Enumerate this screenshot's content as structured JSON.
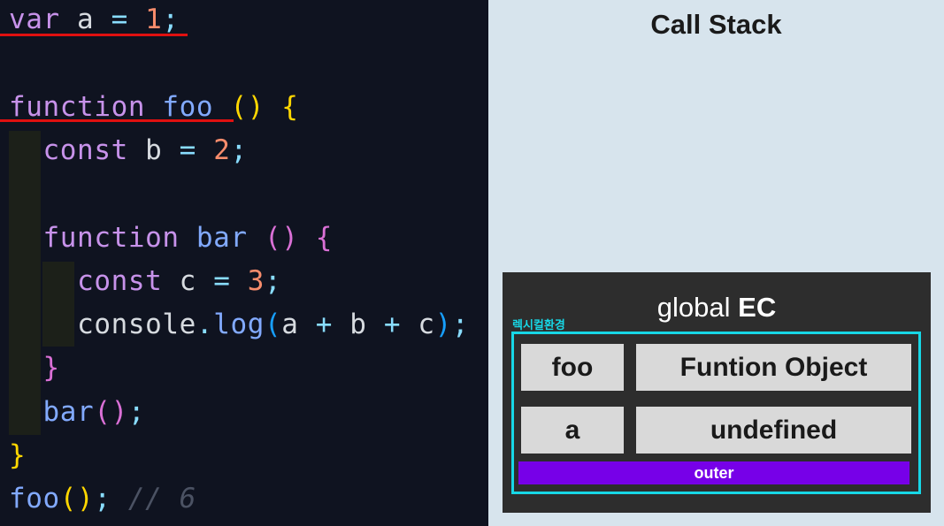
{
  "code": {
    "lines": [
      [
        [
          "var",
          "kw"
        ],
        [
          " a ",
          "var"
        ],
        [
          "=",
          "op"
        ],
        [
          " ",
          "var"
        ],
        [
          "1",
          "num"
        ],
        [
          ";",
          "punc"
        ]
      ],
      [],
      [
        [
          "function",
          "kw"
        ],
        [
          " ",
          "var"
        ],
        [
          "foo",
          "fn"
        ],
        [
          " ",
          "var"
        ],
        [
          "()",
          "brace-y"
        ],
        [
          " ",
          "var"
        ],
        [
          "{",
          "brace-y"
        ]
      ],
      [
        [
          "  ",
          "var"
        ],
        [
          "const",
          "kw"
        ],
        [
          " b ",
          "var"
        ],
        [
          "=",
          "op"
        ],
        [
          " ",
          "var"
        ],
        [
          "2",
          "num"
        ],
        [
          ";",
          "punc"
        ]
      ],
      [],
      [
        [
          "  ",
          "var"
        ],
        [
          "function",
          "kw"
        ],
        [
          " ",
          "var"
        ],
        [
          "bar",
          "fn"
        ],
        [
          " ",
          "var"
        ],
        [
          "()",
          "paren-p"
        ],
        [
          " ",
          "var"
        ],
        [
          "{",
          "paren-p"
        ]
      ],
      [
        [
          "    ",
          "var"
        ],
        [
          "const",
          "kw"
        ],
        [
          " c ",
          "var"
        ],
        [
          "=",
          "op"
        ],
        [
          " ",
          "var"
        ],
        [
          "3",
          "num"
        ],
        [
          ";",
          "punc"
        ]
      ],
      [
        [
          "    ",
          "var"
        ],
        [
          "console",
          "var"
        ],
        [
          ".",
          "punc"
        ],
        [
          "log",
          "fn"
        ],
        [
          "(",
          "paren-b"
        ],
        [
          "a ",
          "var"
        ],
        [
          "+",
          "op"
        ],
        [
          " b ",
          "var"
        ],
        [
          "+",
          "op"
        ],
        [
          " c",
          "var"
        ],
        [
          ")",
          "paren-b"
        ],
        [
          ";",
          "punc"
        ]
      ],
      [
        [
          "  ",
          "var"
        ],
        [
          "}",
          "paren-p"
        ]
      ],
      [
        [
          "  ",
          "var"
        ],
        [
          "bar",
          "fn"
        ],
        [
          "()",
          "paren-p"
        ],
        [
          ";",
          "punc"
        ]
      ],
      [
        [
          "}",
          "brace-y"
        ]
      ],
      [
        [
          "foo",
          "fn"
        ],
        [
          "()",
          "brace-y"
        ],
        [
          ";",
          "punc"
        ],
        [
          " ",
          "var"
        ],
        [
          "// 6",
          "cmt"
        ]
      ]
    ]
  },
  "call_stack": {
    "title": "Call Stack",
    "ec_title_prefix": "global ",
    "ec_title_bold": "EC",
    "lexical_env_label": "렉시컬환경",
    "records": [
      {
        "name": "foo",
        "value": "Funtion Object"
      },
      {
        "name": "a",
        "value": "undefined"
      }
    ],
    "outer_label": "outer"
  },
  "colors": {
    "lexical_env_border": "#17d7e6",
    "outer_bar": "#7700e8",
    "underline": "#e01010"
  }
}
